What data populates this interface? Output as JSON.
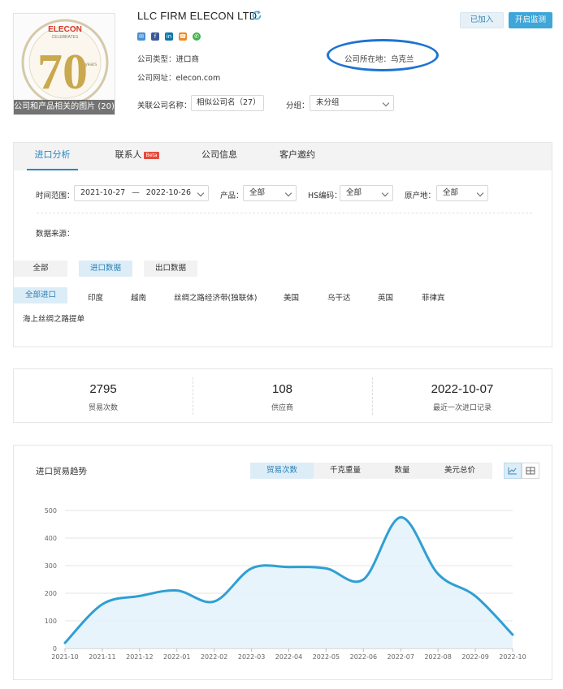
{
  "company": {
    "name": "LLC FIRM ELECON LTD",
    "logo_caption": "公司和产品相关的图片 (20)",
    "logo_brand": "ELECON",
    "logo_sub": "CELEBRATES",
    "logo_number": "70",
    "logo_years": "years",
    "type_label": "公司类型：",
    "type_value": "进口商",
    "location_label": "公司所在地：",
    "location_value": "乌克兰",
    "website_label": "公司网址：",
    "website_value": "elecon.com",
    "related_label": "关联公司名称：",
    "related_button": "相似公司名（27）",
    "group_label": "分组：",
    "group_value": "未分组"
  },
  "actions": {
    "joined": "已加入",
    "monitor": "开启监测"
  },
  "tabs": [
    {
      "label": "进口分析",
      "active": true
    },
    {
      "label": "联系人",
      "badge": "Beta"
    },
    {
      "label": "公司信息"
    },
    {
      "label": "客户邀约"
    }
  ],
  "filters": {
    "time_label": "时间范围：",
    "time_start": "2021-10-27",
    "time_sep": "—",
    "time_end": "2022-10-26",
    "product_label": "产品：",
    "product_value": "全部",
    "hs_label": "HS编码：",
    "hs_value": "全部",
    "origin_label": "原产地：",
    "origin_value": "全部",
    "source_label": "数据来源："
  },
  "data_types": [
    "全部",
    "进口数据",
    "出口数据"
  ],
  "countries": [
    "全部进口",
    "印度",
    "越南",
    "丝绸之路经济带(独联体)",
    "美国",
    "乌干达",
    "英国",
    "菲律宾",
    "海上丝绸之路提单"
  ],
  "stats": [
    {
      "value": "2795",
      "caption": "贸易次数"
    },
    {
      "value": "108",
      "caption": "供应商"
    },
    {
      "value": "2022-10-07",
      "caption": "最近一次进口记录"
    }
  ],
  "chart_panel": {
    "title": "进口贸易趋势",
    "metrics": [
      "贸易次数",
      "千克重量",
      "数量",
      "美元总价"
    ],
    "active_metric": "贸易次数"
  },
  "colors": {
    "accent": "#3fa6d8",
    "line": "#2f9fd4",
    "area": "#e3f2fa",
    "highlight": "#1e73d2"
  },
  "chart_data": {
    "type": "area",
    "title": "进口贸易趋势",
    "x": [
      "2021-10",
      "2021-11",
      "2021-12",
      "2022-01",
      "2022-02",
      "2022-03",
      "2022-04",
      "2022-05",
      "2022-06",
      "2022-07",
      "2022-08",
      "2022-09",
      "2022-10"
    ],
    "series": [
      {
        "name": "贸易次数",
        "values": [
          20,
          160,
          190,
          210,
          170,
          290,
          295,
          290,
          250,
          475,
          270,
          190,
          50
        ]
      }
    ],
    "ylim": [
      0,
      500
    ],
    "yticks": [
      0,
      100,
      200,
      300,
      400,
      500
    ],
    "grid": true,
    "smooth": true
  }
}
